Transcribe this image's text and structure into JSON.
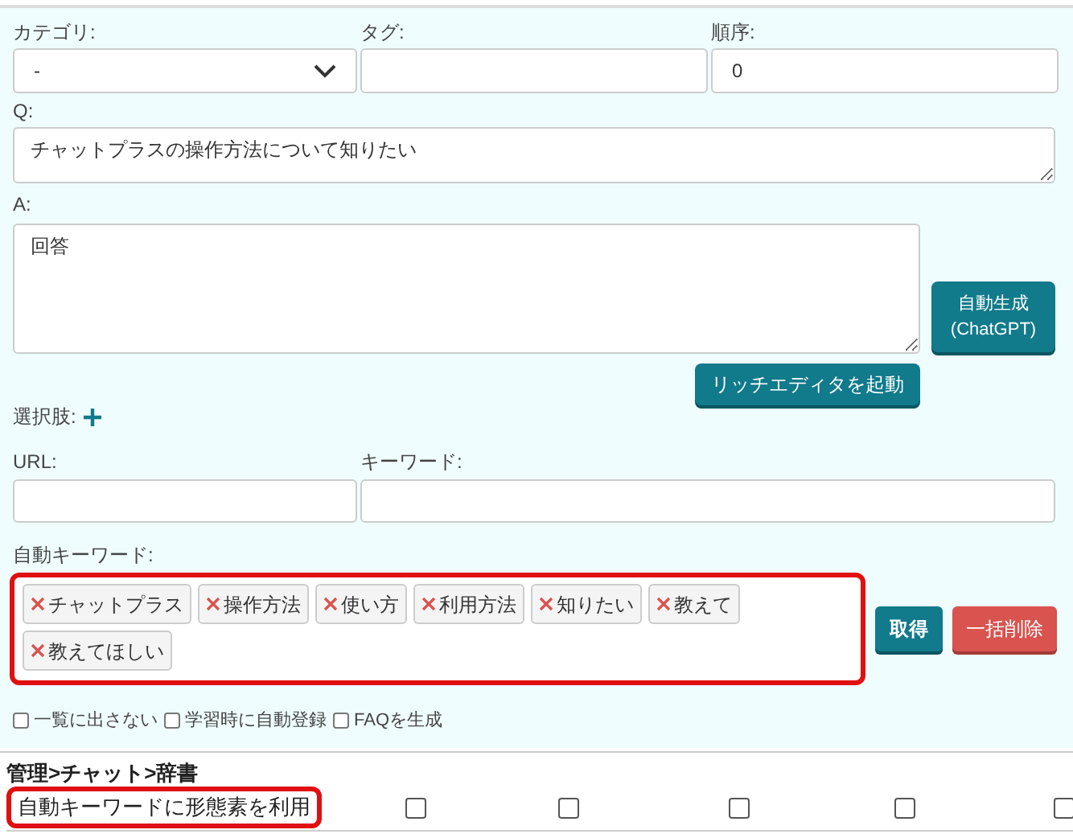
{
  "fields_row1": [
    {
      "label": "カテゴリ:",
      "kind": "select",
      "value": "-"
    },
    {
      "label": "タグ:",
      "kind": "text"
    },
    {
      "label": "順序:",
      "kind": "text",
      "value": "0"
    }
  ],
  "question": {
    "label": "Q:",
    "value": "チャットプラスの操作方法について知りたい"
  },
  "answer": {
    "label": "A:",
    "value": "回答"
  },
  "auto_generate_button": [
    "自動生成",
    "(ChatGPT)"
  ],
  "rich_editor_button": "リッチエディタを起動",
  "choices_label": "選択肢:",
  "fields_row2": [
    {
      "label": "URL:"
    },
    {
      "label": "キーワード:"
    }
  ],
  "auto_keywords": {
    "label": "自動キーワード:",
    "tags": [
      "チャットプラス",
      "操作方法",
      "使い方",
      "利用方法",
      "知りたい",
      "教えて",
      "教えてほしい"
    ],
    "fetch_button": "取得",
    "delete_all_button": "一括削除"
  },
  "options": [
    {
      "label": "一覧に出さない",
      "checked": false
    },
    {
      "label": "学習時に自動登録",
      "checked": false
    },
    {
      "label": "FAQを生成",
      "checked": false
    }
  ],
  "section_title": "管理>チャット>辞書",
  "setting_row": {
    "label": "自動キーワードに形態素を利用",
    "checkboxes": [
      {
        "checked": false
      },
      {
        "checked": false
      },
      {
        "checked": false
      },
      {
        "checked": false
      },
      {
        "checked": false
      }
    ]
  }
}
